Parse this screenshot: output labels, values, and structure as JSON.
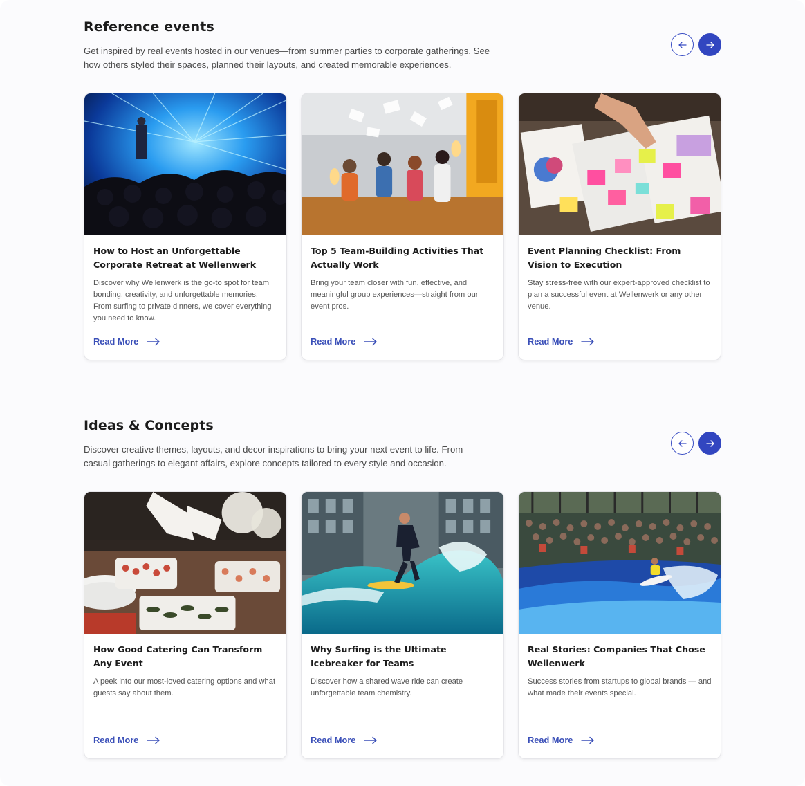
{
  "colors": {
    "accent": "#3246c0",
    "link": "#3a4fb8",
    "background": "#fbfbfd"
  },
  "icons": {
    "prev": "arrow-left-icon",
    "next": "arrow-right-icon",
    "read_more": "long-arrow-right-icon"
  },
  "sections": [
    {
      "title": "Reference events",
      "description": "Get inspired by real events hosted in our venues—from summer parties to corporate gatherings. See how others styled their spaces, planned their layouts, and created memorable experiences.",
      "cards": [
        {
          "image": "conference-stage-blue-lights-photo",
          "title": "How to Host an Unforgettable Corporate Retreat at Wellenwerk",
          "text": "Discover why Wellenwerk is the go-to spot for team bonding, creativity, and unforgettable memories. From surfing to private dinners, we cover everything you need to know.",
          "link": "Read More"
        },
        {
          "image": "team-celebration-office-photo",
          "title": "Top 5 Team-Building Activities That Actually Work",
          "text": "Bring your team closer with fun, effective, and meaningful group experiences—straight from our event pros.",
          "link": "Read More"
        },
        {
          "image": "planning-sticky-notes-photo",
          "title": "Event Planning Checklist: From Vision to Execution",
          "text": "Stay stress-free with our expert-approved checklist to plan a successful event at Wellenwerk or any other venue.",
          "link": "Read More"
        }
      ]
    },
    {
      "title": "Ideas & Concepts",
      "description": "Discover creative themes, layouts, and decor inspirations to bring your next event to life. From casual gatherings to elegant affairs, explore concepts tailored to every style and occasion.",
      "cards": [
        {
          "image": "catering-buffet-photo",
          "title": "How Good Catering Can Transform Any Event",
          "text": "A peek into our most-loved catering options and what guests say about them.",
          "link": "Read More"
        },
        {
          "image": "indoor-surfer-wave-photo",
          "title": "Why Surfing is the Ultimate Icebreaker for Teams",
          "text": "Discover how a shared wave ride can create unforgettable team chemistry.",
          "link": "Read More"
        },
        {
          "image": "surf-crowd-wave-photo",
          "title": "Real Stories: Companies That Chose Wellenwerk",
          "text": "Success stories from startups to global brands — and what made their events special.",
          "link": "Read More"
        }
      ]
    }
  ]
}
